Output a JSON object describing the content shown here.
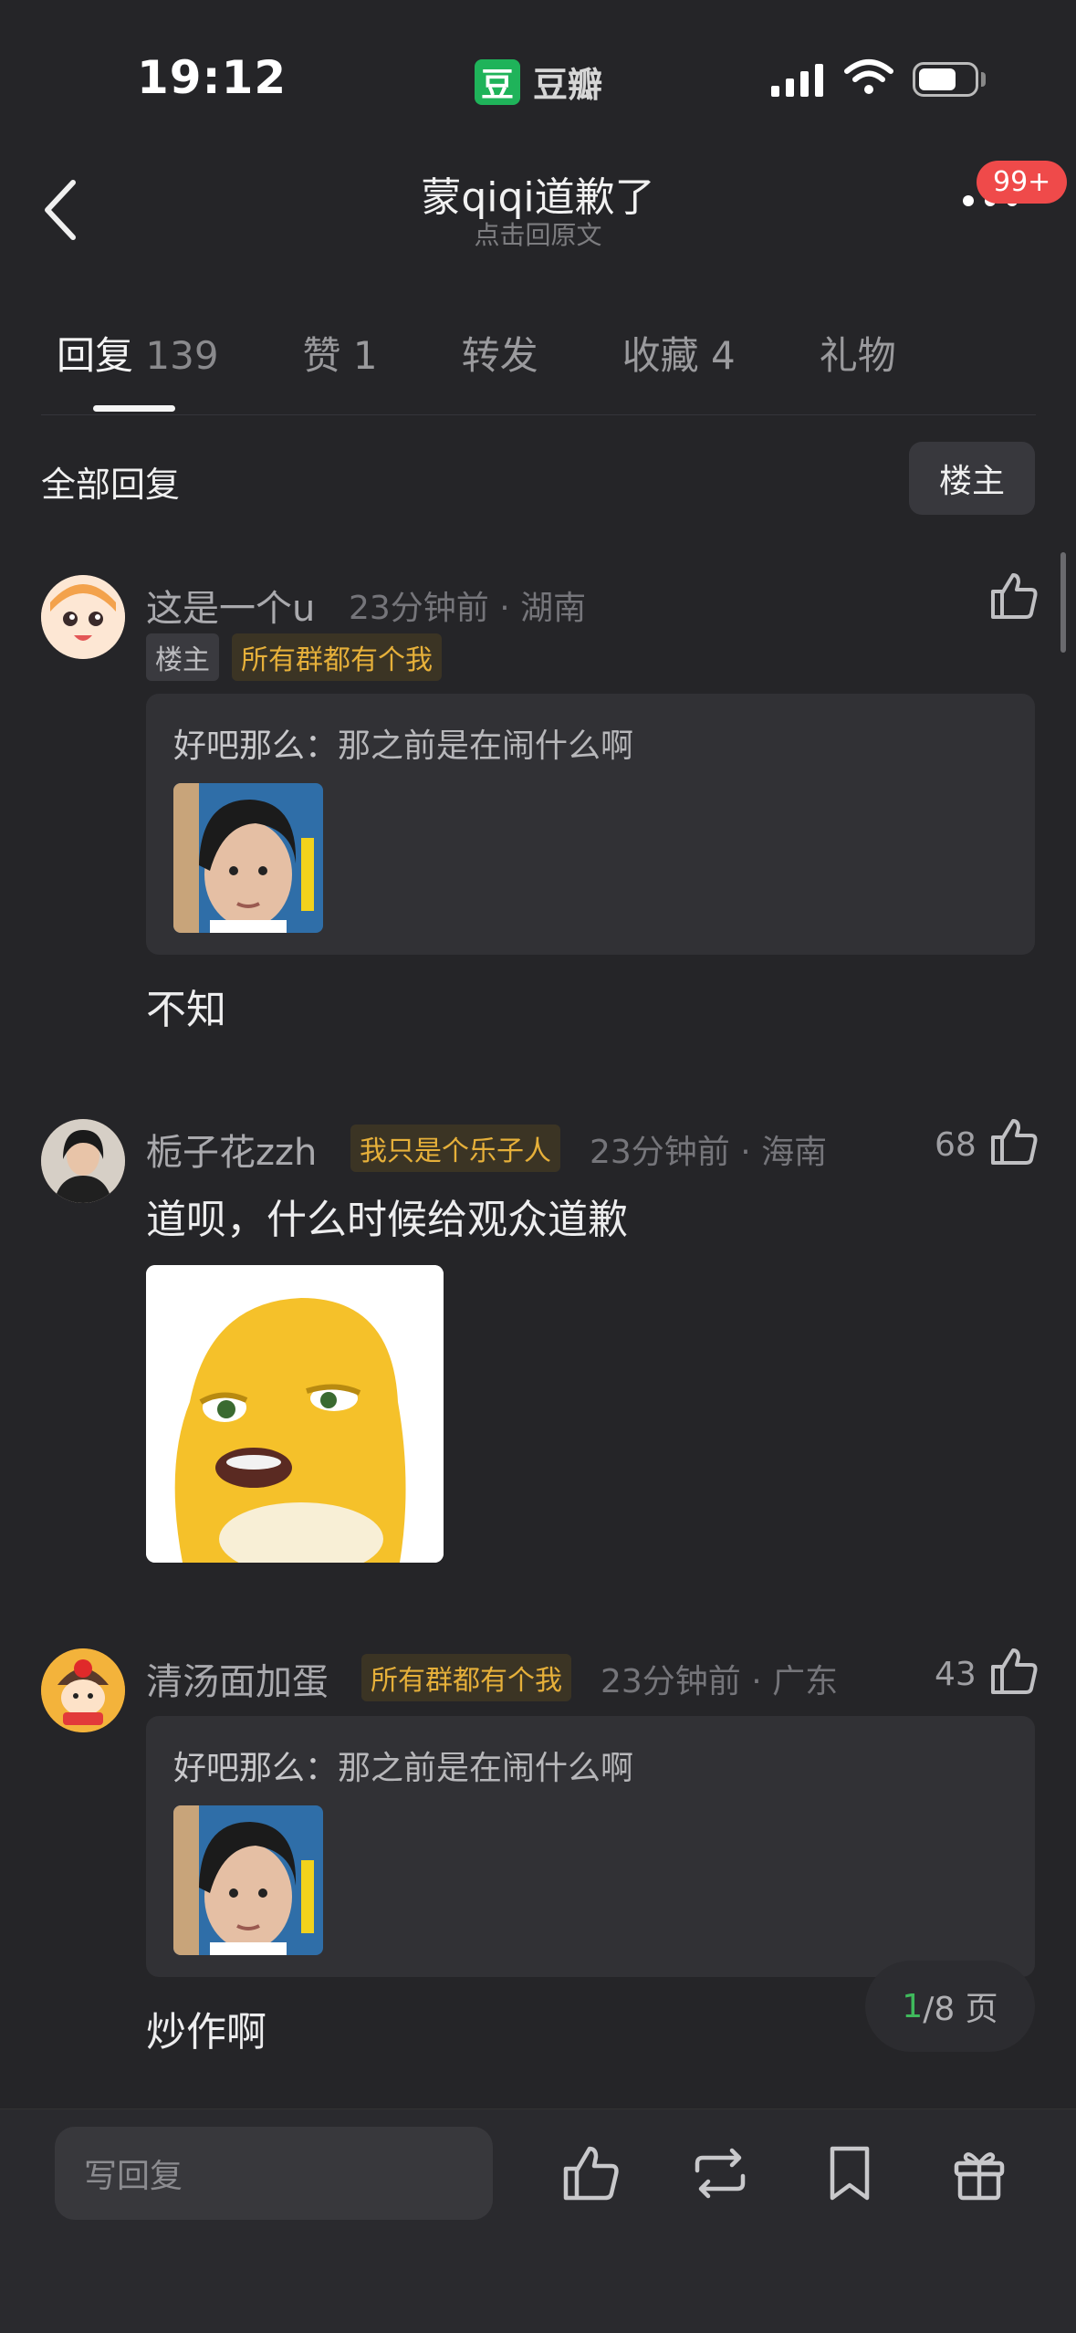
{
  "status_bar": {
    "time": "19:12",
    "app_logo_char": "豆",
    "app_name": "豆瓣"
  },
  "nav": {
    "title": "蒙qiqi道歉了",
    "subtitle": "点击回原文",
    "badge": "99+"
  },
  "tabs": [
    {
      "label": "回复",
      "count": "139"
    },
    {
      "label": "赞",
      "count": "1"
    },
    {
      "label": "转发",
      "count": ""
    },
    {
      "label": "收藏",
      "count": "4"
    },
    {
      "label": "礼物",
      "count": ""
    }
  ],
  "filter": {
    "all_label": "全部回复",
    "op_label": "楼主"
  },
  "comments": [
    {
      "user": "这是一个u",
      "meta": "23分钟前 · 湖南",
      "op_tag": "楼主",
      "tag": "所有群都有个我",
      "quote_author": "好吧那么：",
      "quote_text": "那之前是在闹什么啊",
      "text": "不知",
      "likes": ""
    },
    {
      "user": "栀子花zzh",
      "tag": "我只是个乐子人",
      "meta": "23分钟前 · 海南",
      "text": "道呗，什么时候给观众道歉",
      "likes": "68"
    },
    {
      "user": "清汤面加蛋",
      "tag": "所有群都有个我",
      "meta": "23分钟前 · 广东",
      "quote_author": "好吧那么：",
      "quote_text": "那之前是在闹什么啊",
      "text": "炒作啊",
      "likes": "43"
    }
  ],
  "pager": {
    "current": "1",
    "total": "/8 页"
  },
  "bottom_bar": {
    "reply_placeholder": "写回复"
  },
  "colors": {
    "background": "#252528",
    "accent_green": "#1fb35a",
    "badge_red": "#ef4a4a",
    "tag_gold": "#e6b03a"
  }
}
